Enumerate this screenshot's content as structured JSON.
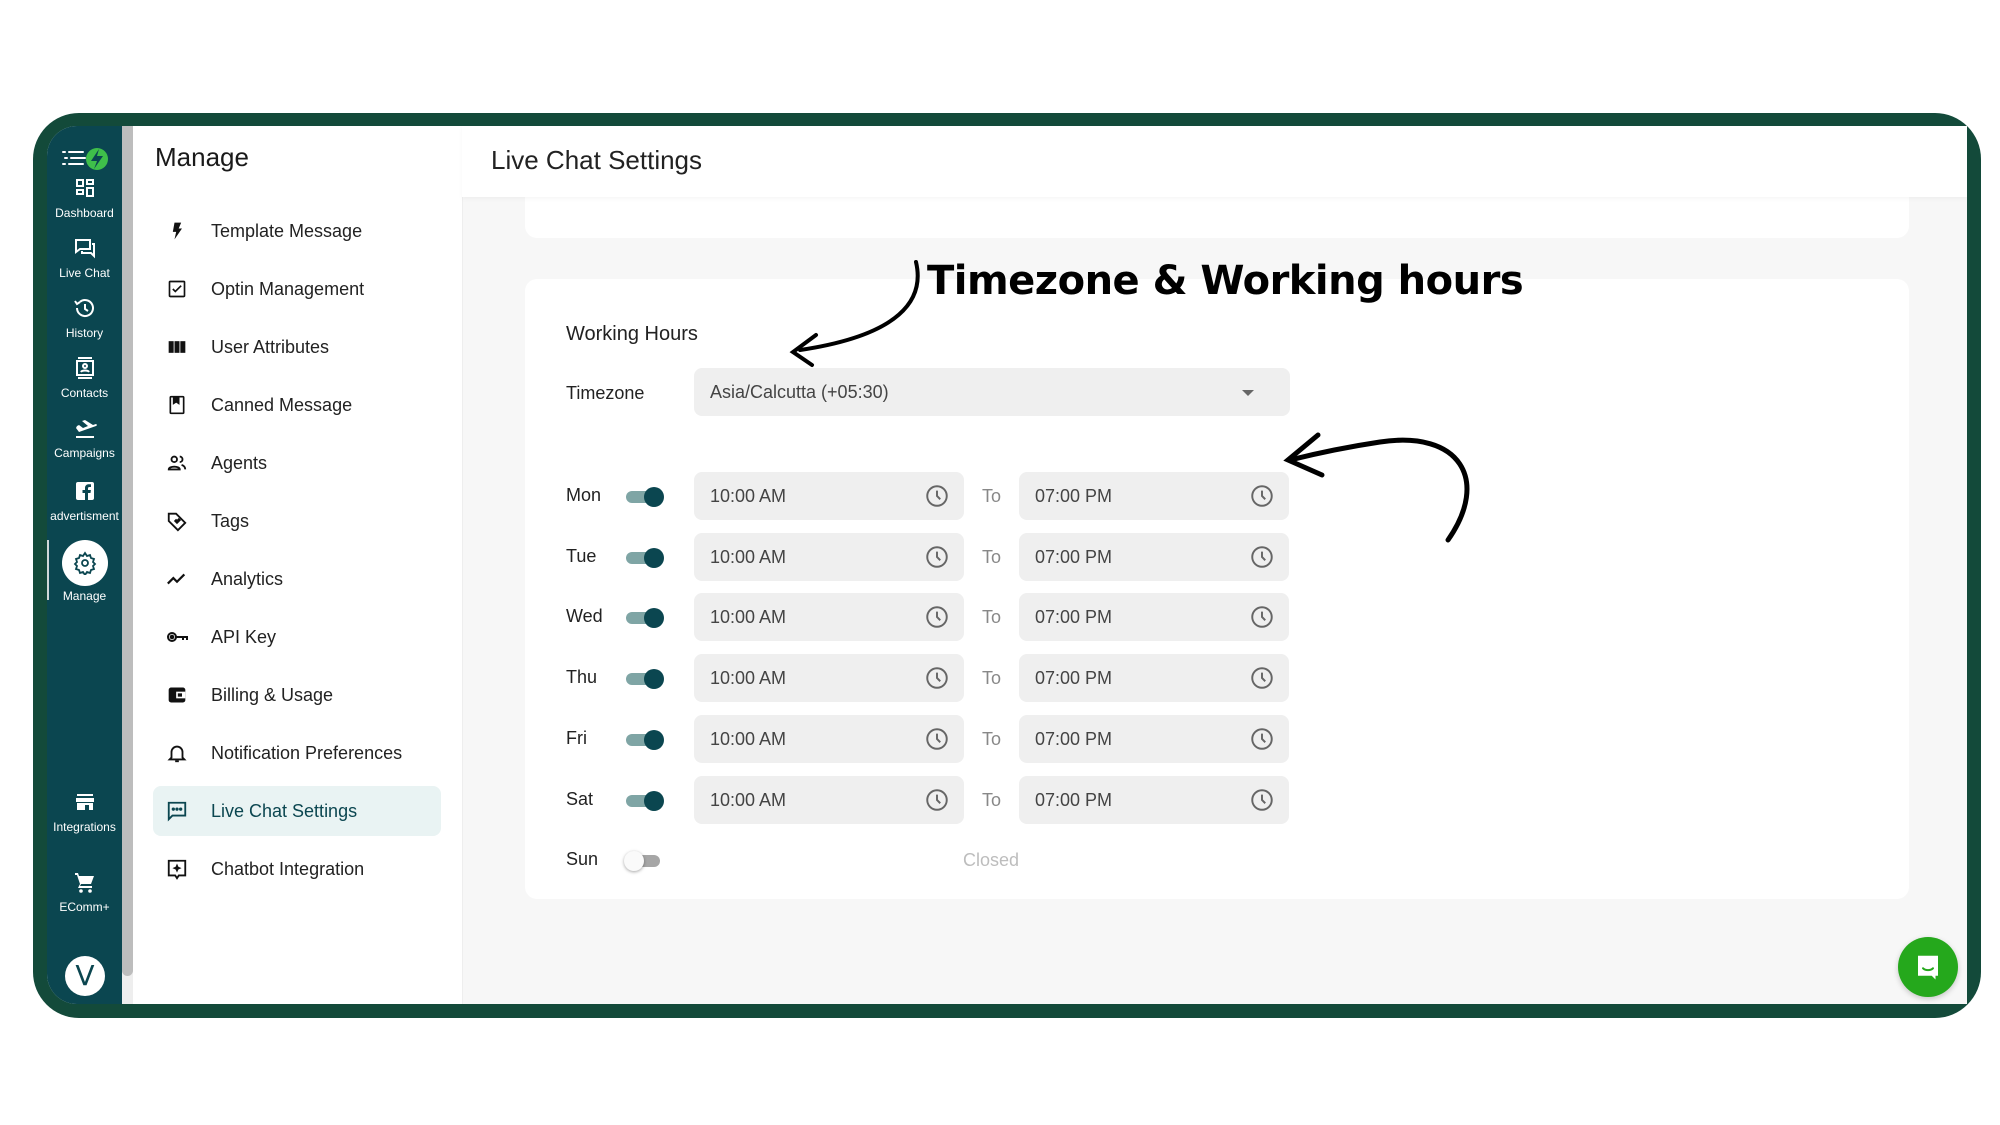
{
  "rail": {
    "logo": "app-logo",
    "items": [
      {
        "label": "Dashboard",
        "icon": "dashboard-icon"
      },
      {
        "label": "Live Chat",
        "icon": "chat-icon"
      },
      {
        "label": "History",
        "icon": "history-icon"
      },
      {
        "label": "Contacts",
        "icon": "contacts-icon"
      },
      {
        "label": "Campaigns",
        "icon": "flight-icon"
      },
      {
        "label": "advertisment",
        "icon": "facebook-icon"
      },
      {
        "label": "Manage",
        "icon": "gear-icon",
        "active": true
      },
      {
        "label": "Integrations",
        "icon": "store-icon"
      },
      {
        "label": "EComm+",
        "icon": "cart-icon"
      }
    ],
    "avatar_initial": "V"
  },
  "manage": {
    "title": "Manage",
    "items": [
      {
        "label": "Template Message",
        "icon": "bolt-icon"
      },
      {
        "label": "Optin Management",
        "icon": "checkbox-icon"
      },
      {
        "label": "User Attributes",
        "icon": "columns-icon"
      },
      {
        "label": "Canned Message",
        "icon": "bookmark-book-icon"
      },
      {
        "label": "Agents",
        "icon": "people-icon"
      },
      {
        "label": "Tags",
        "icon": "tag-icon"
      },
      {
        "label": "Analytics",
        "icon": "trend-icon"
      },
      {
        "label": "API Key",
        "icon": "key-icon"
      },
      {
        "label": "Billing & Usage",
        "icon": "wallet-icon"
      },
      {
        "label": "Notification Preferences",
        "icon": "bell-icon"
      },
      {
        "label": "Live Chat Settings",
        "icon": "chat-bubble-icon",
        "active": true
      },
      {
        "label": "Chatbot Integration",
        "icon": "chatbot-icon"
      }
    ]
  },
  "main": {
    "title": "Live Chat Settings",
    "working_hours": {
      "title": "Working Hours",
      "timezone_label": "Timezone",
      "timezone_value": "Asia/Calcutta (+05:30)",
      "to_label": "To",
      "closed_label": "Closed",
      "days": [
        {
          "day": "Mon",
          "enabled": true,
          "from": "10:00 AM",
          "to": "07:00 PM"
        },
        {
          "day": "Tue",
          "enabled": true,
          "from": "10:00 AM",
          "to": "07:00 PM"
        },
        {
          "day": "Wed",
          "enabled": true,
          "from": "10:00 AM",
          "to": "07:00 PM"
        },
        {
          "day": "Thu",
          "enabled": true,
          "from": "10:00 AM",
          "to": "07:00 PM"
        },
        {
          "day": "Fri",
          "enabled": true,
          "from": "10:00 AM",
          "to": "07:00 PM"
        },
        {
          "day": "Sat",
          "enabled": true,
          "from": "10:00 AM",
          "to": "07:00 PM"
        },
        {
          "day": "Sun",
          "enabled": false,
          "from": "",
          "to": ""
        }
      ]
    }
  },
  "annotation": {
    "text": "Timezone & Working hours"
  },
  "colors": {
    "frame": "#134a3a",
    "rail": "#0b4650",
    "accent": "#0b4650",
    "fab": "#25a81c"
  }
}
